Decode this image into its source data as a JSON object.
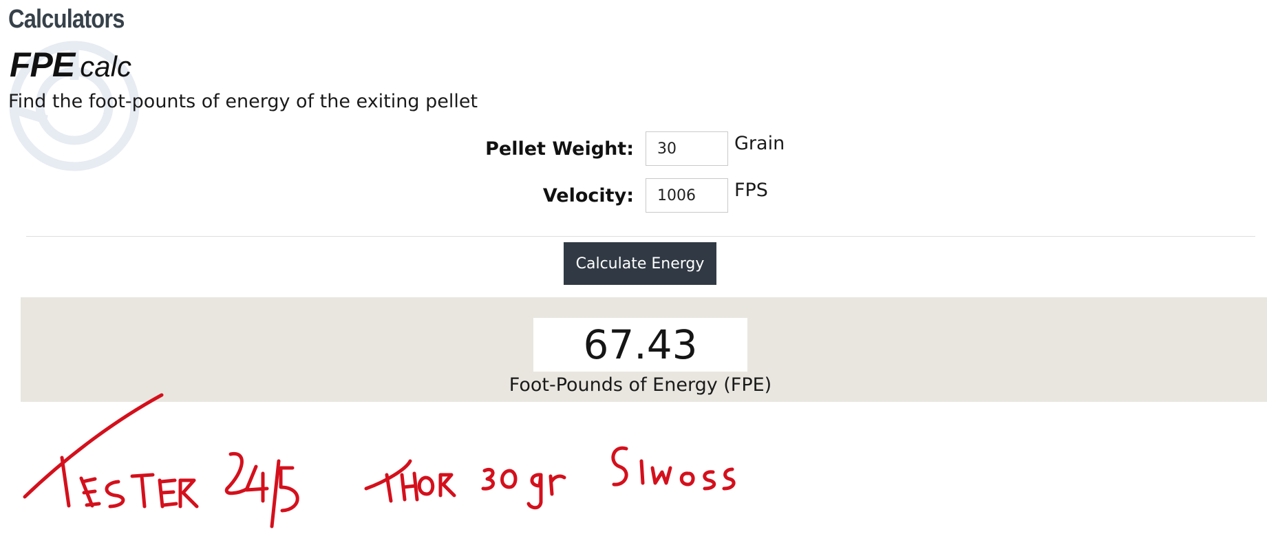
{
  "page": {
    "heading": "Calculators"
  },
  "calculator": {
    "title_bold": "FPE",
    "title_light": "calc",
    "description": "Find the foot-pounts of energy of the exiting pellet",
    "fields": {
      "pellet_weight": {
        "label": "Pellet Weight:",
        "value": "30",
        "unit": "Grain"
      },
      "velocity": {
        "label": "Velocity:",
        "value": "1006",
        "unit": "FPS"
      }
    },
    "button_label": "Calculate Energy"
  },
  "result": {
    "value": "67.43",
    "label": "Foot-Pounds of Energy (FPE)"
  },
  "annotation": {
    "handwritten_text": "Tester 24/5 Thor 30 gr Slugs",
    "ink_color": "#d4101c"
  },
  "colors": {
    "heading": "#37414a",
    "button_bg": "#313a44",
    "result_panel_bg": "#e9e6e0",
    "watermark": "#e7ecf3"
  }
}
